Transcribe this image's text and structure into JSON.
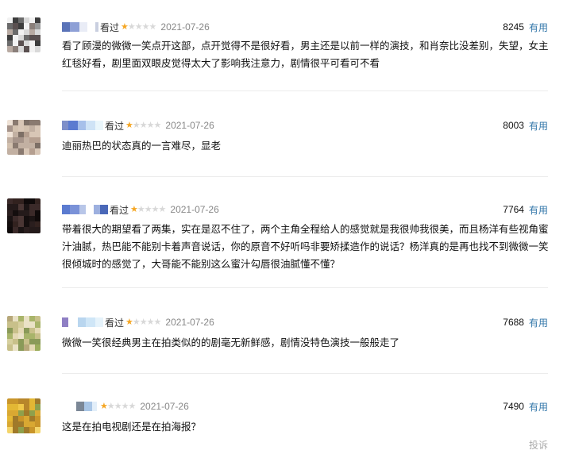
{
  "reviews": [
    {
      "watched_label": "看过",
      "rating_stars": 1,
      "rating_max": 5,
      "date": "2021-07-26",
      "vote_count": "8245",
      "useful_label": "有用",
      "comment": "看了顾漫的微微一笑点开这部，点开觉得不是很好看，男主还是以前一样的演技，和肖奈比没差别，失望，女主红毯好看，剧里面双眼皮觉得太大了影响我注意力，剧情很平可看可不看"
    },
    {
      "watched_label": "看过",
      "rating_stars": 1,
      "rating_max": 5,
      "date": "2021-07-26",
      "vote_count": "8003",
      "useful_label": "有用",
      "comment": "迪丽热巴的状态真的一言难尽，显老"
    },
    {
      "watched_label": "看过",
      "rating_stars": 1,
      "rating_max": 5,
      "date": "2021-07-26",
      "vote_count": "7764",
      "useful_label": "有用",
      "comment": "带着很大的期望看了两集，实在是忍不住了，两个主角全程给人的感觉就是我很帅我很美，而且杨洋有些视角蜜汁油腻，热巴能不能别卡着声音说话，你的原音不好听吗非要矫揉造作的说话？杨洋真的是再也找不到微微一笑很倾城时的感觉了，大哥能不能别这么蜜汁勾唇很油腻懂不懂？"
    },
    {
      "watched_label": "看过",
      "rating_stars": 1,
      "rating_max": 5,
      "date": "2021-07-26",
      "vote_count": "7688",
      "useful_label": "有用",
      "comment": "微微一笑很经典男主在拍类似的的剧毫无新鲜感，剧情没特色演技一般般走了"
    },
    {
      "watched_label": "",
      "rating_stars": 1,
      "rating_max": 5,
      "date": "2021-07-26",
      "vote_count": "7490",
      "useful_label": "有用",
      "comment": "这是在拍电视剧还是在拍海报？"
    }
  ],
  "report_label": "投诉",
  "colors": {
    "star_on": "#f5a623",
    "star_off": "#d8d8d8",
    "useful_link": "#3377aa",
    "date": "#888888",
    "divider": "#ececec"
  }
}
